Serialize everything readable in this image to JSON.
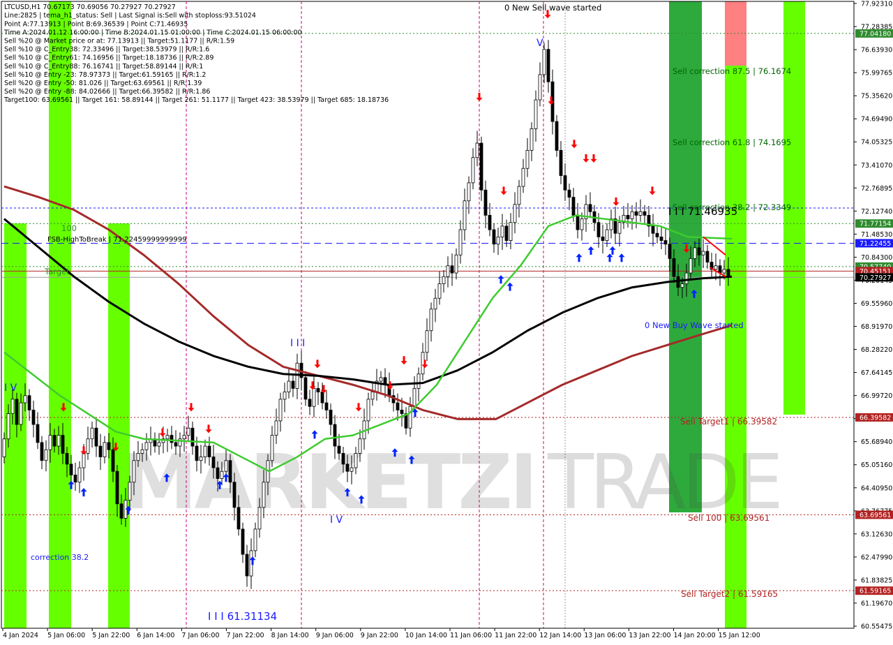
{
  "header": {
    "symbol_line": "LTCUSD,H1  70.67173 70.69056 70.27927 70.27927",
    "info_lines": [
      "Line:2825 | tema_h1_status: Sell | Last Signal is:Sell with stoploss:93.51024",
      "Point A:77.13913 | Point B:69.36539 | Point C:71.46935",
      "Time A:2024.01.12 16:00:00 | Time B:2024.01.15 01:00:00 | Time C:2024.01.15 06:00:00",
      "Sell %20 @ Market price or at: 77.13913 || Target:51.1177 || R/R:1.59",
      "Sell %10 @ C_Entry38: 72.33496 || Target:38.53979 || R/R:1.6",
      "Sell %10 @ C_Entry61: 74.16956 || Target:18.18736 || R/R:2.89",
      "Sell %10 @ C_Entry88: 76.16741 || Target:58.89144 || R/R:1",
      "Sell %10 @ Entry -23: 78.97373 || Target:61.59165 || R/R:1.2",
      "Sell %20 @ Entry -50: 81.026 || Target:63.69561 || R/R:1.39",
      "Sell %20 @ Entry -88: 84.02666 || Target:66.39582 || R/R:1.86",
      "Target100: 63.69561 || Target 161: 58.89144 || Target 261: 51.1177 || Target 423: 38.53979 || Target 685: 18.18736"
    ]
  },
  "colors": {
    "background": "#ffffff",
    "bull_candle": "#000000",
    "bear_candle": "#000000",
    "green_zone": "#66ff00",
    "dark_green_zone": "#2eaa3c",
    "red_zone": "#ff8080",
    "ma_black": "#000000",
    "ma_green": "#3ecb2e",
    "ma_brown": "#a52a2a",
    "buy_arrow": "#0022ff",
    "sell_arrow": "#ff0000",
    "target_red": "#b22222",
    "blue_line": "#1a1aff",
    "grid_magenta": "#cc0077"
  },
  "annotations": {
    "new_sell_wave": "0 New Sell wave started",
    "new_buy_wave": "0 New Buy Wave started",
    "sell_corr_875": "Sell correction 87.5 | 76.1674",
    "sell_corr_618": "Sell correction 61.8 | 74.1695",
    "sell_corr_382": "Sell correction 38.2 | 72.3349",
    "point_c_label": "I I I 71.46935",
    "fsb_label": "FSB-HighToBreak | 71.22459999999999",
    "label_100": "100",
    "label_target": "Target",
    "sell_target1": "Sell Target1 | 66.39582",
    "sell_100": "Sell 100 | 63.69561",
    "sell_target2": "Sell Target2 | 61.59165",
    "correction_382": "correction 38.2",
    "low_label": "I I I 61.31134",
    "wave_iv_left": "I V",
    "wave_iii_mid": "I I I",
    "wave_iv_mid": "I V",
    "wave_v_top": "V",
    "watermark_left": "MARKETZI",
    "watermark_right": "TRADE"
  },
  "price_labels": [
    {
      "value": "77.04180",
      "price": 77.0418,
      "bg": "#2e8b2e",
      "fg": "#ffffff"
    },
    {
      "value": "71.77154",
      "price": 71.77154,
      "bg": "#2e8b2e",
      "fg": "#ffffff"
    },
    {
      "value": "71.22455",
      "price": 71.22455,
      "bg": "#1a1aff",
      "fg": "#ffffff"
    },
    {
      "value": "70.57740",
      "price": 70.5774,
      "bg": "#2e8b2e",
      "fg": "#ffffff"
    },
    {
      "value": "70.45151",
      "price": 70.45151,
      "bg": "#b22222",
      "fg": "#ffffff"
    },
    {
      "value": "70.27927",
      "price": 70.27927,
      "bg": "#000000",
      "fg": "#ffffff"
    },
    {
      "value": "66.39582",
      "price": 66.39582,
      "bg": "#b22222",
      "fg": "#ffffff"
    },
    {
      "value": "63.69561",
      "price": 63.69561,
      "bg": "#b22222",
      "fg": "#ffffff"
    },
    {
      "value": "61.59165",
      "price": 61.59165,
      "bg": "#b22222",
      "fg": "#ffffff"
    }
  ],
  "chart_data": {
    "type": "candlestick",
    "symbol": "LTCUSD",
    "timeframe": "H1",
    "ylim": [
      60.55,
      77.93
    ],
    "y_ticks": [
      "77.92310",
      "77.28385",
      "76.63930",
      "75.99765",
      "75.35620",
      "74.69490",
      "74.05325",
      "73.41070",
      "72.76895",
      "72.12740",
      "71.48530",
      "70.84300",
      "70.20145",
      "69.55960",
      "68.91970",
      "68.28220",
      "67.64145",
      "66.99720",
      "66.35825",
      "65.68940",
      "65.05160",
      "64.40950",
      "63.76775",
      "63.12630",
      "62.47990",
      "61.83825",
      "61.19670",
      "60.55475"
    ],
    "x_ticks": [
      "4 Jan 2024",
      "5 Jan 06:00",
      "5 Jan 22:00",
      "6 Jan 14:00",
      "7 Jan 06:00",
      "7 Jan 22:00",
      "8 Jan 14:00",
      "9 Jan 06:00",
      "9 Jan 22:00",
      "10 Jan 14:00",
      "11 Jan 06:00",
      "11 Jan 22:00",
      "12 Jan 14:00",
      "13 Jan 06:00",
      "13 Jan 22:00",
      "14 Jan 20:00",
      "15 Jan 12:00"
    ],
    "price_path": [
      [
        0,
        65.3
      ],
      [
        6,
        65.8
      ],
      [
        12,
        66.5
      ],
      [
        18,
        66.9
      ],
      [
        24,
        66.2
      ],
      [
        30,
        66.8
      ],
      [
        36,
        67.0
      ],
      [
        42,
        66.6
      ],
      [
        48,
        66.2
      ],
      [
        54,
        65.7
      ],
      [
        60,
        65.2
      ],
      [
        66,
        65.5
      ],
      [
        72,
        65.9
      ],
      [
        78,
        65.6
      ],
      [
        84,
        65.9
      ],
      [
        90,
        65.4
      ],
      [
        96,
        65.1
      ],
      [
        102,
        64.8
      ],
      [
        108,
        64.6
      ],
      [
        114,
        65.0
      ],
      [
        120,
        65.4
      ],
      [
        126,
        65.8
      ],
      [
        132,
        66.1
      ],
      [
        138,
        65.6
      ],
      [
        144,
        65.3
      ],
      [
        150,
        65.7
      ],
      [
        156,
        65.5
      ],
      [
        162,
        64.9
      ],
      [
        168,
        64.0
      ],
      [
        174,
        63.6
      ],
      [
        180,
        64.1
      ],
      [
        186,
        64.6
      ],
      [
        192,
        65.2
      ],
      [
        198,
        65.4
      ],
      [
        204,
        65.5
      ],
      [
        210,
        65.7
      ],
      [
        216,
        65.8
      ],
      [
        222,
        65.6
      ],
      [
        228,
        65.7
      ],
      [
        234,
        65.8
      ],
      [
        240,
        65.9
      ],
      [
        246,
        65.7
      ],
      [
        252,
        65.6
      ],
      [
        258,
        65.8
      ],
      [
        264,
        65.9
      ],
      [
        270,
        66.1
      ],
      [
        276,
        65.6
      ],
      [
        282,
        65.2
      ],
      [
        288,
        65.3
      ],
      [
        294,
        65.6
      ],
      [
        300,
        65.3
      ],
      [
        306,
        65.0
      ],
      [
        312,
        64.7
      ],
      [
        318,
        64.9
      ],
      [
        324,
        65.2
      ],
      [
        330,
        64.6
      ],
      [
        336,
        63.9
      ],
      [
        342,
        63.3
      ],
      [
        348,
        62.6
      ],
      [
        354,
        62.0
      ],
      [
        360,
        62.7
      ],
      [
        366,
        63.3
      ],
      [
        372,
        63.9
      ],
      [
        378,
        64.6
      ],
      [
        384,
        65.2
      ],
      [
        390,
        65.9
      ],
      [
        396,
        66.3
      ],
      [
        402,
        66.9
      ],
      [
        408,
        67.1
      ],
      [
        414,
        67.4
      ],
      [
        420,
        67.2
      ],
      [
        426,
        67.9
      ],
      [
        432,
        67.5
      ],
      [
        438,
        66.9
      ],
      [
        444,
        66.7
      ],
      [
        450,
        67.2
      ],
      [
        456,
        67.1
      ],
      [
        462,
        66.8
      ],
      [
        468,
        66.6
      ],
      [
        474,
        66.2
      ],
      [
        480,
        65.6
      ],
      [
        486,
        65.4
      ],
      [
        492,
        65.1
      ],
      [
        498,
        64.9
      ],
      [
        504,
        65.0
      ],
      [
        510,
        65.4
      ],
      [
        516,
        65.8
      ],
      [
        522,
        66.3
      ],
      [
        528,
        66.9
      ],
      [
        534,
        67.1
      ],
      [
        540,
        67.4
      ],
      [
        546,
        67.5
      ],
      [
        552,
        67.3
      ],
      [
        558,
        67.0
      ],
      [
        564,
        66.8
      ],
      [
        570,
        66.6
      ],
      [
        576,
        66.5
      ],
      [
        582,
        66.1
      ],
      [
        588,
        66.7
      ],
      [
        594,
        67.2
      ],
      [
        600,
        67.6
      ],
      [
        606,
        68.2
      ],
      [
        612,
        68.8
      ],
      [
        618,
        69.4
      ],
      [
        624,
        69.7
      ],
      [
        630,
        70.1
      ],
      [
        636,
        70.3
      ],
      [
        642,
        70.6
      ],
      [
        648,
        70.4
      ],
      [
        654,
        70.9
      ],
      [
        660,
        71.6
      ],
      [
        666,
        72.4
      ],
      [
        672,
        72.9
      ],
      [
        678,
        73.6
      ],
      [
        684,
        74.0
      ],
      [
        690,
        72.7
      ],
      [
        696,
        72.0
      ],
      [
        702,
        71.6
      ],
      [
        708,
        71.2
      ],
      [
        714,
        71.4
      ],
      [
        720,
        71.7
      ],
      [
        726,
        71.3
      ],
      [
        732,
        71.8
      ],
      [
        738,
        72.3
      ],
      [
        744,
        72.8
      ],
      [
        750,
        73.3
      ],
      [
        756,
        73.8
      ],
      [
        762,
        74.4
      ],
      [
        768,
        75.2
      ],
      [
        774,
        75.9
      ],
      [
        780,
        76.6
      ],
      [
        786,
        75.7
      ],
      [
        792,
        74.6
      ],
      [
        798,
        73.8
      ],
      [
        804,
        73.1
      ],
      [
        810,
        72.7
      ],
      [
        816,
        72.5
      ],
      [
        822,
        72.0
      ],
      [
        828,
        71.6
      ],
      [
        834,
        71.9
      ],
      [
        840,
        72.3
      ],
      [
        846,
        72.1
      ],
      [
        852,
        71.8
      ],
      [
        858,
        71.4
      ],
      [
        864,
        71.3
      ],
      [
        870,
        71.6
      ],
      [
        876,
        71.9
      ],
      [
        882,
        71.5
      ],
      [
        888,
        71.8
      ],
      [
        894,
        72.0
      ],
      [
        900,
        71.9
      ],
      [
        906,
        72.1
      ],
      [
        912,
        72.0
      ],
      [
        918,
        72.1
      ],
      [
        924,
        72.0
      ],
      [
        930,
        71.7
      ],
      [
        936,
        71.5
      ],
      [
        942,
        71.4
      ],
      [
        948,
        71.3
      ],
      [
        954,
        71.2
      ],
      [
        960,
        70.8
      ],
      [
        966,
        70.3
      ],
      [
        972,
        70.0
      ],
      [
        978,
        70.1
      ],
      [
        984,
        70.4
      ],
      [
        990,
        70.8
      ],
      [
        996,
        71.1
      ],
      [
        1002,
        70.9
      ],
      [
        1008,
        71.0
      ],
      [
        1014,
        70.7
      ],
      [
        1020,
        70.5
      ],
      [
        1026,
        70.6
      ],
      [
        1032,
        70.4
      ],
      [
        1038,
        70.5
      ],
      [
        1043,
        70.28
      ]
    ],
    "ma_black": [
      [
        0,
        71.9
      ],
      [
        50,
        71.1
      ],
      [
        100,
        70.3
      ],
      [
        150,
        69.6
      ],
      [
        200,
        69.0
      ],
      [
        250,
        68.5
      ],
      [
        300,
        68.1
      ],
      [
        350,
        67.8
      ],
      [
        400,
        67.6
      ],
      [
        450,
        67.55
      ],
      [
        500,
        67.45
      ],
      [
        550,
        67.3
      ],
      [
        600,
        67.35
      ],
      [
        650,
        67.7
      ],
      [
        700,
        68.2
      ],
      [
        750,
        68.8
      ],
      [
        800,
        69.3
      ],
      [
        850,
        69.7
      ],
      [
        900,
        70.0
      ],
      [
        950,
        70.15
      ],
      [
        1000,
        70.25
      ],
      [
        1043,
        70.3
      ]
    ],
    "ma_brown": [
      [
        0,
        72.8
      ],
      [
        50,
        72.5
      ],
      [
        100,
        72.15
      ],
      [
        150,
        71.6
      ],
      [
        200,
        70.9
      ],
      [
        250,
        70.1
      ],
      [
        300,
        69.2
      ],
      [
        350,
        68.4
      ],
      [
        400,
        67.8
      ],
      [
        450,
        67.55
      ],
      [
        500,
        67.3
      ],
      [
        550,
        67.0
      ],
      [
        600,
        66.6
      ],
      [
        650,
        66.35
      ],
      [
        705,
        66.35
      ],
      [
        750,
        66.8
      ],
      [
        800,
        67.3
      ],
      [
        850,
        67.7
      ],
      [
        900,
        68.1
      ],
      [
        950,
        68.4
      ],
      [
        1000,
        68.7
      ],
      [
        1043,
        68.95
      ]
    ],
    "ma_green": [
      [
        0,
        68.2
      ],
      [
        40,
        67.6
      ],
      [
        80,
        67.0
      ],
      [
        120,
        66.5
      ],
      [
        160,
        66.0
      ],
      [
        200,
        65.8
      ],
      [
        250,
        65.75
      ],
      [
        300,
        65.7
      ],
      [
        340,
        65.3
      ],
      [
        380,
        64.9
      ],
      [
        420,
        65.3
      ],
      [
        460,
        65.8
      ],
      [
        500,
        65.9
      ],
      [
        540,
        66.2
      ],
      [
        580,
        66.5
      ],
      [
        620,
        67.3
      ],
      [
        660,
        68.5
      ],
      [
        700,
        69.7
      ],
      [
        740,
        70.6
      ],
      [
        780,
        71.7
      ],
      [
        820,
        72.0
      ],
      [
        860,
        71.9
      ],
      [
        900,
        71.8
      ],
      [
        940,
        71.7
      ],
      [
        980,
        71.4
      ],
      [
        1043,
        71.35
      ]
    ],
    "series": [
      {
        "name": "LTCUSD"
      }
    ]
  }
}
